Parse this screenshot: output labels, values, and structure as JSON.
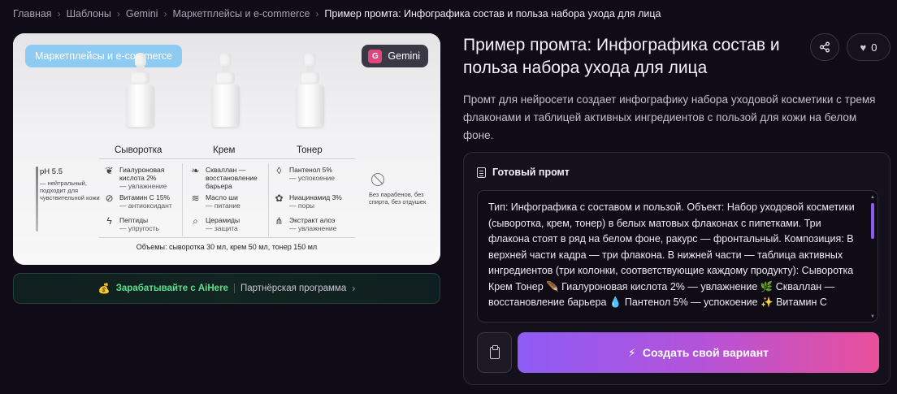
{
  "breadcrumb": {
    "items": [
      "Главная",
      "Шаблоны",
      "Gemini",
      "Маркетплейсы и e-commerce"
    ],
    "current": "Пример промта: Инфографика состав и польза набора ухода для лица",
    "separator": "›"
  },
  "preview": {
    "category_tag": "Маркетплейсы и e-commerce",
    "model_tag": "Gemini",
    "model_badge": "G",
    "columns": [
      "Сыворотка",
      "Крем",
      "Тонер"
    ],
    "ph": {
      "title": "pH 5.5",
      "text": "— нейтральный, подходит для чувствительной кожи"
    },
    "ingredients": [
      [
        {
          "icon": "leaf-icon",
          "name": "Гиалуроновая кислота 2%",
          "effect": "— увлажнение"
        },
        {
          "icon": "capsule-icon",
          "name": "Витамин С 15%",
          "effect": "— антиоксидант"
        },
        {
          "icon": "bolt-icon",
          "name": "Пептиды",
          "effect": "— упругость"
        }
      ],
      [
        {
          "icon": "sprout-icon",
          "name": "Скваллан — восстановление барьера",
          "effect": ""
        },
        {
          "icon": "stack-icon",
          "name": "Масло ши",
          "effect": "— питание"
        },
        {
          "icon": "search-icon",
          "name": "Церамиды",
          "effect": "— защита"
        }
      ],
      [
        {
          "icon": "drop-icon",
          "name": "Пантенол 5%",
          "effect": "— успокоение"
        },
        {
          "icon": "flower-icon",
          "name": "Ниацинамид 3%",
          "effect": "— поры"
        },
        {
          "icon": "aloe-icon",
          "name": "Экстракт алоэ",
          "effect": "— увлажнение"
        }
      ]
    ],
    "free_from": "Без парабенов, без спирта, без отдушек",
    "volumes": "Объемы: сыворотка 30 мл, крем 50 мл, тонер 150 мл"
  },
  "earn": {
    "label": "Зарабатывайте с AiHere",
    "partner": "Партнёрская программа"
  },
  "page": {
    "title": "Пример промта: Инфографика состав и польза набора ухода для лица",
    "description": "Промт для нейросети создает инфографику набора уходовой косметики с тремя флаконами и таблицей активных ингредиентов с пользой для кожи на белом фоне.",
    "likes": "0"
  },
  "prompt": {
    "header": "Готовый промт",
    "text": "Тип: Инфографика с составом и пользой. Объект: Набор уходовой косметики (сыворотка, крем, тонер) в белых матовых флаконах с пипетками. Три флакона стоят в ряд на белом фоне, ракурс — фронтальный. Композиция: В верхней части кадра — три флакона. В нижней части — таблица активных ингредиентов (три колонки, соответствующие каждому продукту): Сыворотка     Крем     Тонер  🪶 Гиалуроновая кислота 2% — увлажнение     🌿 Скваллан — восстановление барьера  💧 Пантенол 5% — успокоение  ✨ Витамин С",
    "create_label": "Создать свой вариант"
  }
}
